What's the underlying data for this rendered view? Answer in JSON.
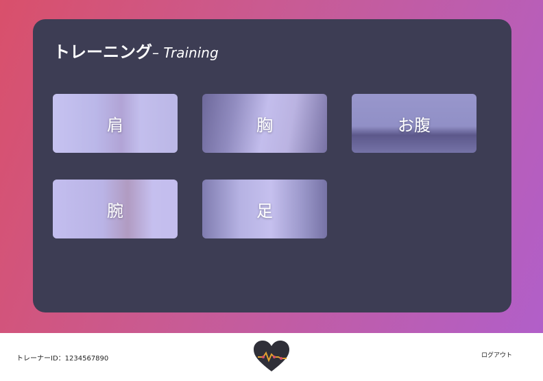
{
  "header": {
    "title": "トレーニング",
    "subtitle": "– Training"
  },
  "categories": [
    {
      "label": "肩",
      "image": "shoulder-workout-photo"
    },
    {
      "label": "胸",
      "image": "chest-workout-photo"
    },
    {
      "label": "お腹",
      "image": "abs-plank-photo"
    },
    {
      "label": "腕",
      "image": "arm-dumbbell-photo"
    },
    {
      "label": "足",
      "image": "leg-workout-photo"
    }
  ],
  "footer": {
    "trainer_id": "トレーナーID：1234567890",
    "logout_label": "ログアウト",
    "logo": "heart-pulse-logo"
  },
  "colors": {
    "gradient_start": "#d9506b",
    "gradient_end": "#b15fc9",
    "panel": "#3d3d54",
    "card_tint": "#968ceb"
  }
}
